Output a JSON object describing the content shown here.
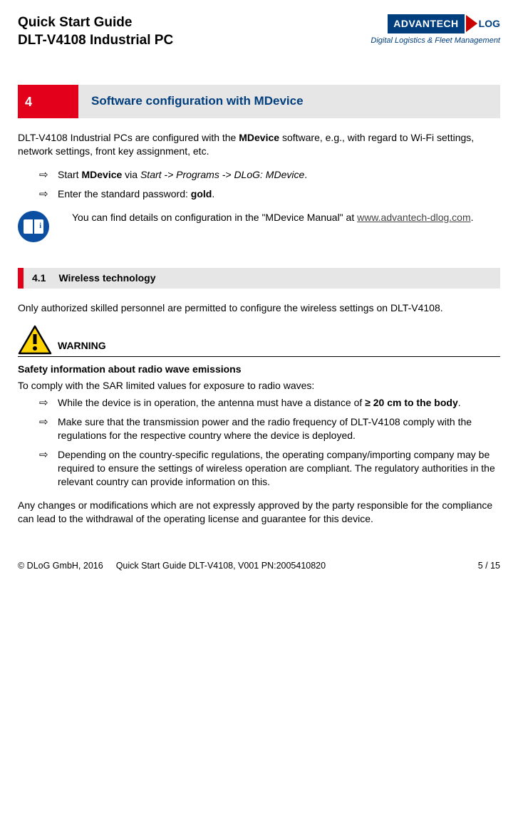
{
  "header": {
    "title_line1": "Quick Start Guide",
    "title_line2": "DLT-V4108 Industrial PC",
    "logo_advantech": "ADVANTECH",
    "logo_dlog": "LOG",
    "tagline": "Digital Logistics & Fleet Management"
  },
  "section4": {
    "num": "4",
    "title": "Software configuration with MDevice",
    "intro_pre": "DLT-V4108 Industrial PCs are configured with the ",
    "intro_bold": "MDevice",
    "intro_post": " software, e.g., with regard to Wi-Fi settings, network settings, front key assignment, etc.",
    "steps": {
      "s1_pre": "Start ",
      "s1_bold": "MDevice",
      "s1_mid": " via ",
      "s1_italic": "Start -> Programs -> DLoG: MDevice",
      "s1_end": ".",
      "s2_pre": "Enter the standard password: ",
      "s2_bold": "gold",
      "s2_end": "."
    },
    "infobox_pre": "You can find details on configuration in the \"MDevice Manual\" at ",
    "infobox_link": "www.advantech-dlog.com",
    "infobox_end": "."
  },
  "section41": {
    "num": "4.1",
    "title": "Wireless technology",
    "intro": "Only authorized skilled personnel are permitted to configure the wireless settings on DLT-V4108.",
    "warning_label": "WARNING",
    "safety_heading": "Safety information about radio wave emissions",
    "sar_intro": "To comply with the SAR limited values for exposure to radio waves:",
    "bullets": {
      "b1_pre": "While the device is in operation, the antenna must have a distance of ",
      "b1_bold": "≥ 20 cm to the body",
      "b1_end": ".",
      "b2": "Make sure that the transmission power and the radio frequency of DLT-V4108 comply with the regulations for the respective country where the device is deployed.",
      "b3": "Depending on the country-specific regulations, the operating company/importing company may be required to ensure the settings of wireless operation are compliant. The regulatory authorities in the relevant country can provide information on this."
    },
    "closing": "Any changes or modifications which are not expressly approved by the party responsible for the compliance can lead to the withdrawal of the operating license and guarantee for this device."
  },
  "footer": {
    "copyright": "© DLoG GmbH, 2016",
    "doc": "Quick Start Guide DLT-V4108,  V001   PN:2005410820",
    "page": "5 / 15"
  }
}
